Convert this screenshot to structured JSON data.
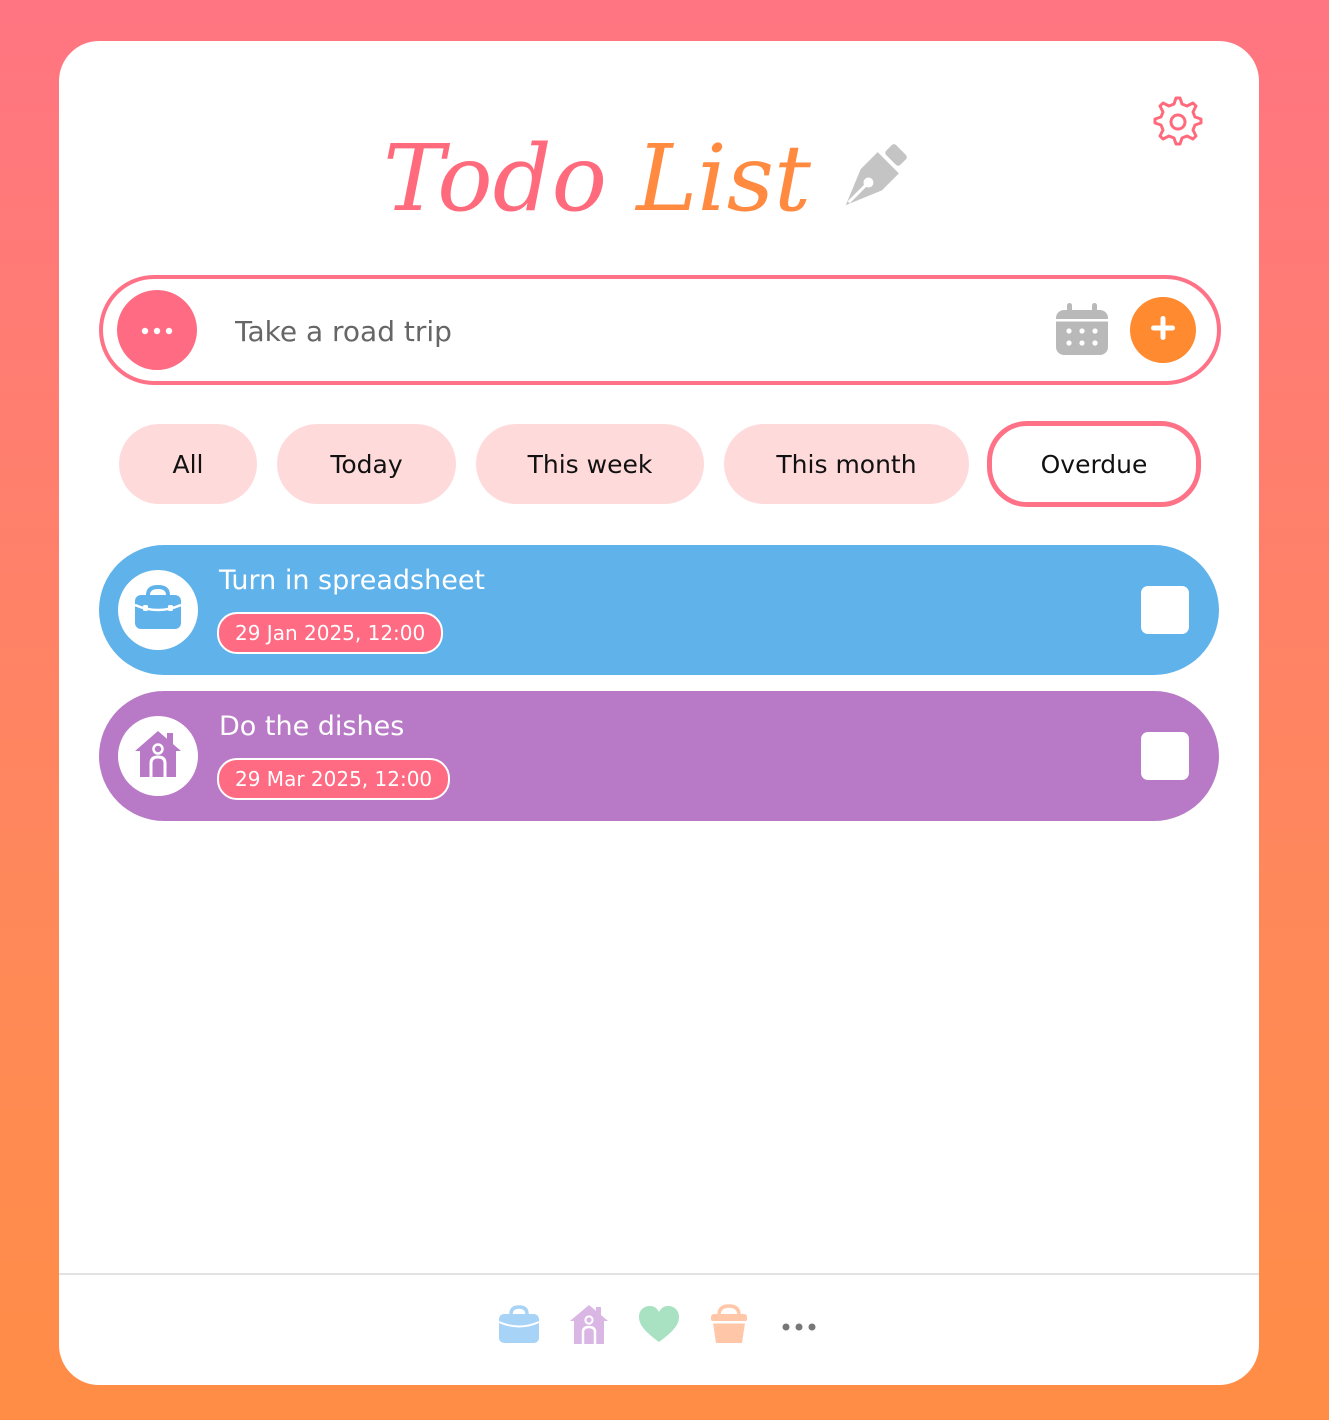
{
  "header": {
    "title_word1": "Todo",
    "title_word2": "List",
    "pen_icon": "fountain-pen-icon",
    "settings_icon": "gear-icon"
  },
  "input": {
    "placeholder": "Take a road trip",
    "value": ""
  },
  "filters": [
    {
      "label": "All",
      "active": false
    },
    {
      "label": "Today",
      "active": false
    },
    {
      "label": "This week",
      "active": false
    },
    {
      "label": "This month",
      "active": false
    },
    {
      "label": "Overdue",
      "active": true
    }
  ],
  "tasks": [
    {
      "title": "Turn in spreadsheet",
      "date": "29 Jan 2025, 12:00",
      "category": "work",
      "icon": "briefcase-icon",
      "color": "#60b2eb"
    },
    {
      "title": "Do the dishes",
      "date": "29 Mar 2025, 12:00",
      "category": "home",
      "icon": "house-icon",
      "color": "#b87ac7"
    }
  ],
  "footer": {
    "categories": [
      {
        "name": "work",
        "icon": "briefcase-icon",
        "color": "#a7d3f7"
      },
      {
        "name": "home",
        "icon": "house-icon",
        "color": "#d9b6e3"
      },
      {
        "name": "health",
        "icon": "heart-icon",
        "color": "#a8e2c2"
      },
      {
        "name": "shopping",
        "icon": "basket-icon",
        "color": "#ffc7a8"
      },
      {
        "name": "more",
        "icon": "more-dots-icon",
        "color": "#777777"
      }
    ]
  },
  "colors": {
    "accent_pink": "#ff6b83",
    "accent_orange": "#ff8a2f",
    "filter_bg": "#ffdadb"
  }
}
